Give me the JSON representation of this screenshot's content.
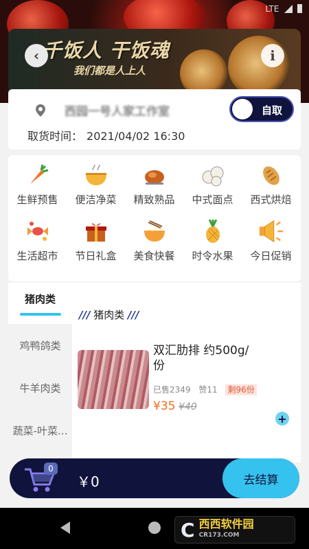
{
  "status_bar": {
    "network": "LTE"
  },
  "banner": {
    "slogan": "千饭人 干饭魂",
    "subtitle": "我们都是人上人"
  },
  "location": {
    "shop_name": "西园一号人家工作室",
    "pickup_toggle_label": "自取",
    "pickup_time_label": "取货时间：",
    "pickup_time": "2021/04/02 16:30"
  },
  "categories": [
    {
      "label": "生鲜预售",
      "icon": "carrot-icon"
    },
    {
      "label": "便洁净菜",
      "icon": "bowl-icon"
    },
    {
      "label": "精致熟品",
      "icon": "roast-chicken-icon"
    },
    {
      "label": "中式面点",
      "icon": "dumpling-icon"
    },
    {
      "label": "西式烘焙",
      "icon": "bread-icon"
    },
    {
      "label": "生活超市",
      "icon": "candy-icon"
    },
    {
      "label": "节日礼盒",
      "icon": "gift-box-icon"
    },
    {
      "label": "美食快餐",
      "icon": "noodle-bowl-icon"
    },
    {
      "label": "时令水果",
      "icon": "pineapple-icon"
    },
    {
      "label": "今日促销",
      "icon": "megaphone-icon"
    }
  ],
  "sidebar": {
    "items": [
      {
        "label": "猪肉类",
        "active": true
      },
      {
        "label": "鸡鸭鸽类",
        "active": false
      },
      {
        "label": "牛羊肉类",
        "active": false
      },
      {
        "label": "蔬菜-叶菜...",
        "active": false
      }
    ]
  },
  "section": {
    "title": "猪肉类"
  },
  "product": {
    "name": "双汇肋排 约500g/份",
    "sold": "已售2349",
    "likes": "赞11",
    "stock": "剩96份",
    "price": "¥35",
    "original_price": "¥40"
  },
  "cart": {
    "count": "0",
    "total": "￥0",
    "checkout_label": "去结算"
  },
  "watermark": {
    "brand": "西西软件园",
    "url": "CR173.COM"
  },
  "colors": {
    "accent": "#36c2ee",
    "navy": "#10143c",
    "price": "#f26b1d"
  }
}
